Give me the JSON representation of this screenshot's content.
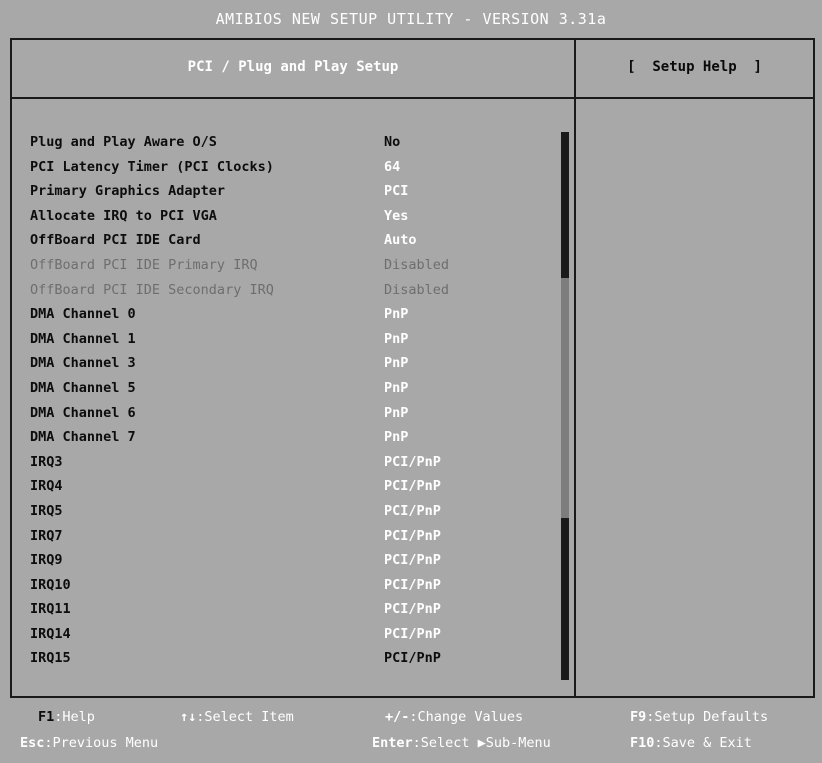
{
  "header": {
    "title": "AMIBIOS NEW SETUP UTILITY - VERSION 3.31a"
  },
  "panel": {
    "title": "PCI / Plug and Play Setup",
    "help_title": "[  Setup Help  ]"
  },
  "settings": [
    {
      "label": "Plug and Play Aware O/S",
      "value": "No",
      "state": "highlight"
    },
    {
      "label": "PCI Latency Timer (PCI Clocks)",
      "value": "64",
      "state": "normal"
    },
    {
      "label": "Primary Graphics Adapter",
      "value": "PCI",
      "state": "normal"
    },
    {
      "label": "Allocate IRQ to PCI VGA",
      "value": "Yes",
      "state": "normal"
    },
    {
      "label": "OffBoard PCI IDE Card",
      "value": "Auto",
      "state": "normal"
    },
    {
      "label": "OffBoard PCI IDE Primary IRQ",
      "value": "Disabled",
      "state": "disabled"
    },
    {
      "label": "OffBoard PCI IDE Secondary IRQ",
      "value": "Disabled",
      "state": "disabled"
    },
    {
      "label": "DMA Channel 0",
      "value": "PnP",
      "state": "normal"
    },
    {
      "label": "DMA Channel 1",
      "value": "PnP",
      "state": "normal"
    },
    {
      "label": "DMA Channel 3",
      "value": "PnP",
      "state": "normal"
    },
    {
      "label": "DMA Channel 5",
      "value": "PnP",
      "state": "normal"
    },
    {
      "label": "DMA Channel 6",
      "value": "PnP",
      "state": "normal"
    },
    {
      "label": "DMA Channel 7",
      "value": "PnP",
      "state": "normal"
    },
    {
      "label": "IRQ3",
      "value": "PCI/PnP",
      "state": "normal"
    },
    {
      "label": "IRQ4",
      "value": "PCI/PnP",
      "state": "normal"
    },
    {
      "label": "IRQ5",
      "value": "PCI/PnP",
      "state": "normal"
    },
    {
      "label": "IRQ7",
      "value": "PCI/PnP",
      "state": "normal"
    },
    {
      "label": "IRQ9",
      "value": "PCI/PnP",
      "state": "normal"
    },
    {
      "label": "IRQ10",
      "value": "PCI/PnP",
      "state": "normal"
    },
    {
      "label": "IRQ11",
      "value": "PCI/PnP",
      "state": "normal"
    },
    {
      "label": "IRQ14",
      "value": "PCI/PnP",
      "state": "normal"
    },
    {
      "label": "IRQ15",
      "value": "PCI/PnP",
      "state": "highlight"
    }
  ],
  "scrollbar": {
    "arrow": "▼"
  },
  "footer": {
    "f1": {
      "key": "F1",
      "text": ":Help"
    },
    "arrows": {
      "key": "↑↓",
      "text": ":Select Item"
    },
    "plusminus": {
      "key": "+/-",
      "text": ":Change Values"
    },
    "f9": {
      "key": "F9",
      "text": ":Setup Defaults"
    },
    "esc": {
      "key": "Esc",
      "text": ":Previous Menu"
    },
    "enter": {
      "key": "Enter",
      "text": ":Select ▶Sub-Menu"
    },
    "f10": {
      "key": "F10",
      "text": ":Save & Exit"
    }
  },
  "colors": {
    "background": "#a8a8a8",
    "frame": "#1a1a1a",
    "text_dark": "#0d0d0d",
    "text_light": "#ffffff",
    "disabled": "#6e6e6e"
  }
}
